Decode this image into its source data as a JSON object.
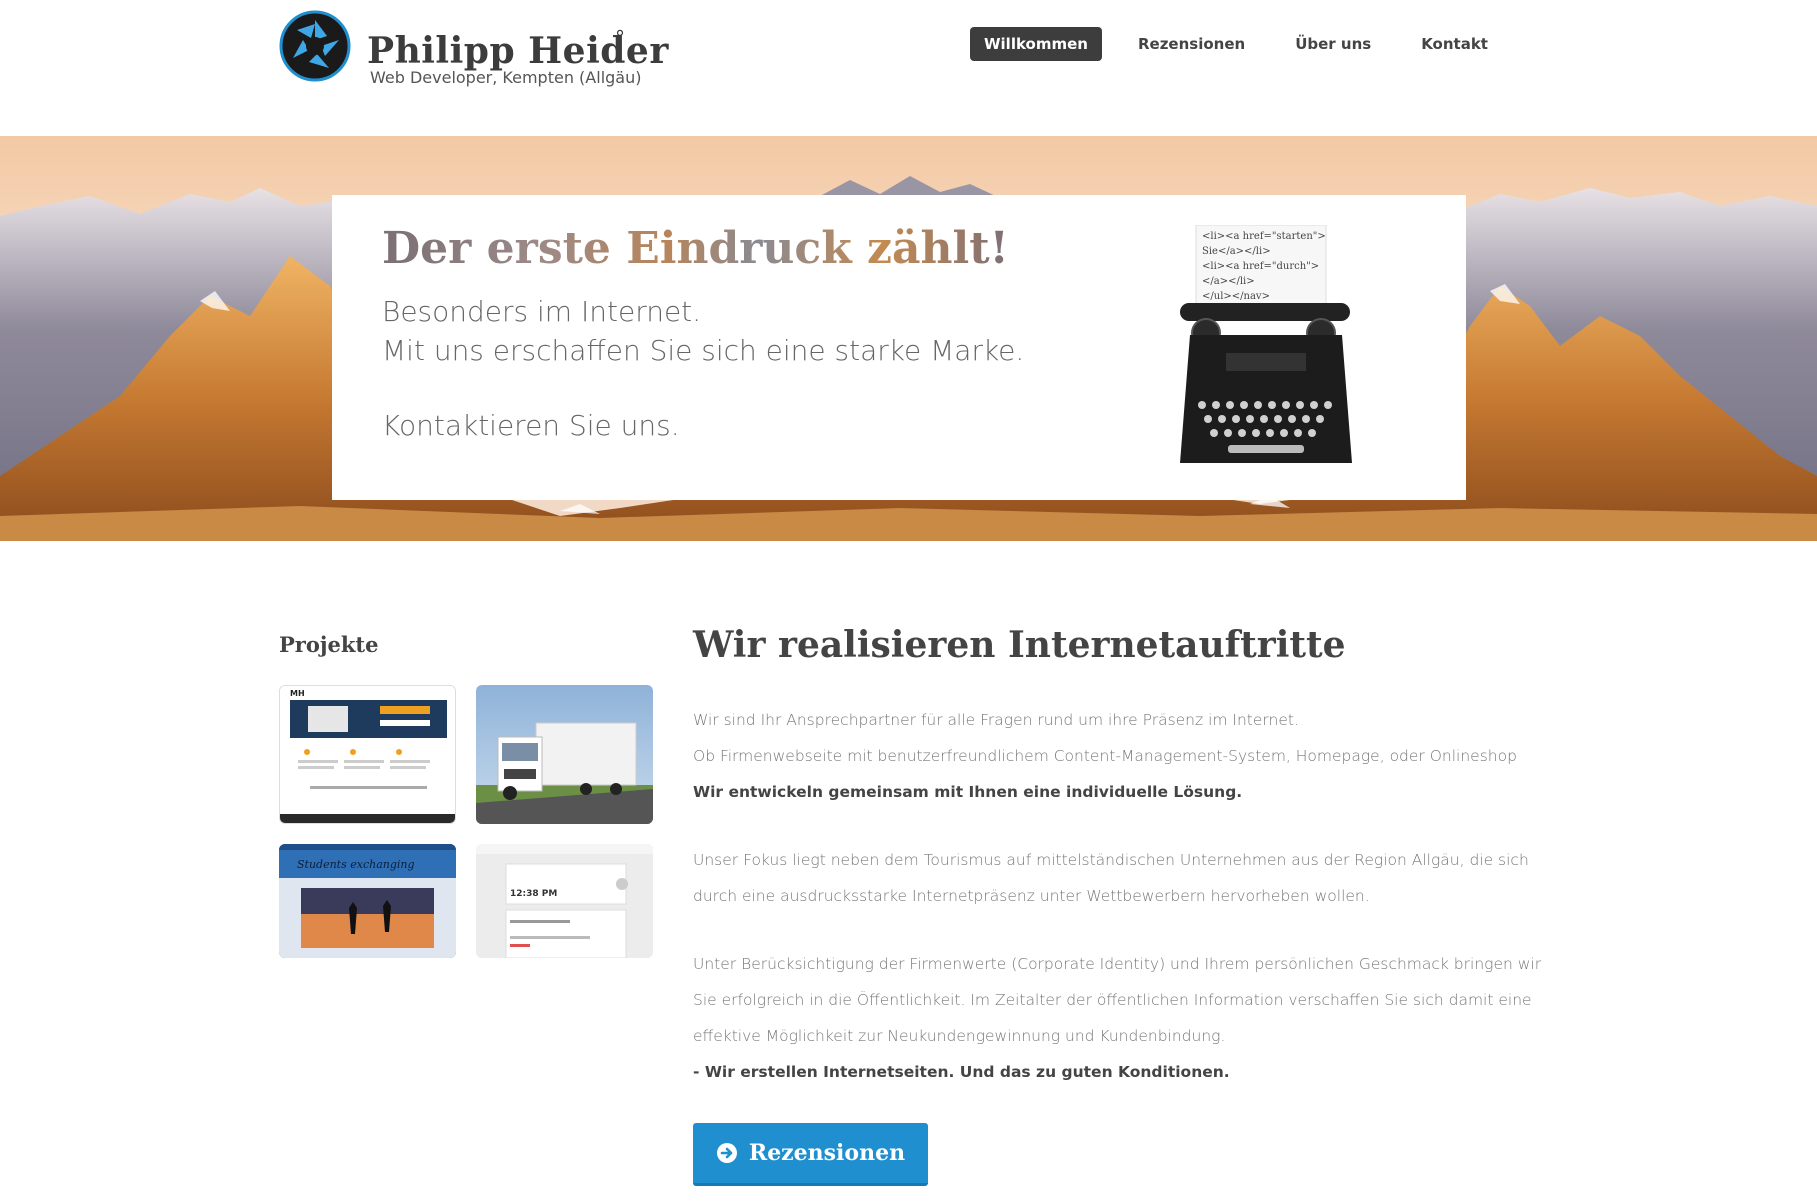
{
  "header": {
    "brand_name": "Philipp Heider",
    "brand_degree": "°",
    "brand_subtitle": "Web Developer, Kempten (Allgäu)",
    "nav": [
      {
        "label": "Willkommen",
        "active": true
      },
      {
        "label": "Rezensionen",
        "active": false
      },
      {
        "label": "Über uns",
        "active": false
      },
      {
        "label": "Kontakt",
        "active": false
      }
    ]
  },
  "hero": {
    "title": "Der erste Eindruck zählt!",
    "line1": "Besonders im Internet.",
    "line2": "Mit uns erschaffen Sie sich eine starke Marke.",
    "line3": "Kontaktieren Sie uns.",
    "typewriter_paper": [
      "<li><a href=\"starten\">",
      "Sie</a></li>",
      "<li><a href=\"durch\">",
      "</a></li>",
      "</ul></nav>"
    ]
  },
  "projects": {
    "title": "Projekte",
    "thumbs": [
      {
        "name": "project-mh-website",
        "label": "MH"
      },
      {
        "name": "project-truck-photo",
        "label": ""
      },
      {
        "name": "project-students-exchanging",
        "label": "Students exchanging"
      },
      {
        "name": "project-calendar-app",
        "label": "12:38 PM"
      }
    ]
  },
  "main": {
    "title": "Wir realisieren Internetauftritte",
    "p1": "Wir sind Ihr Ansprechpartner für alle Fragen rund um ihre Präsenz im Internet.",
    "p2": "Ob Firmenwebseite mit benutzerfreundlichem Content-Management-System, Homepage, oder Onlineshop",
    "p3": "Wir entwickeln gemeinsam mit Ihnen eine individuelle Lösung.",
    "p4": "Unser Fokus liegt neben dem Tourismus auf mittelständischen Unternehmen aus der Region Allgäu, die sich",
    "p5": "durch eine ausdrucksstarke Internetpräsenz unter Wettbewerbern hervorheben wollen.",
    "p6": "Unter Berücksichtigung der Firmenwerte (Corporate Identity) und Ihrem persönlichen Geschmack bringen wir",
    "p7": "Sie erfolgreich in die Öffentlichkeit. Im Zeitalter der öffentlichen Information verschaffen Sie sich damit eine",
    "p8": "effektive Möglichkeit zur Neukundengewinnung und Kundenbindung.",
    "p9": "- Wir erstellen Internetseiten. Und das zu guten Konditionen.",
    "cta_label": "Rezensionen"
  },
  "colors": {
    "accent": "#1f8fcf",
    "nav_active_bg": "#3d3d3d",
    "heading": "#444444",
    "body_text": "#777777"
  }
}
